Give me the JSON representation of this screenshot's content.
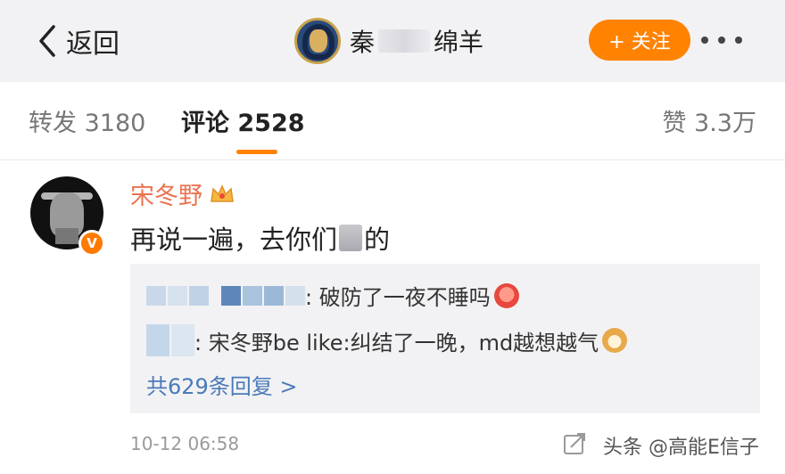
{
  "nav": {
    "back_label": "返回",
    "title_visible_start": "秦",
    "title_visible_end": "绵羊",
    "follow_label": "+ 关注"
  },
  "tabs": {
    "repost": "转发 3180",
    "comment": "评论 2528",
    "like": "赞 3.3万"
  },
  "comment": {
    "author": "宋冬野",
    "text_before": "再说一遍，去你们",
    "text_after": "的",
    "replies": [
      {
        "text": ": 破防了一夜不睡吗"
      },
      {
        "text": ": 宋冬野be like:纠结了一晚，md越想越气"
      }
    ],
    "more_replies": "共629条回复 >",
    "time": "10-12 06:58"
  },
  "watermark": "头条 @高能E信子",
  "colors": {
    "accent": "#ff8200",
    "author_name": "#eb7350",
    "link": "#4a7ab8",
    "nav_bg": "#f2f2f4"
  },
  "icons": [
    "back-chevron-icon",
    "more-dots-icon",
    "crown-icon",
    "verified-v-icon",
    "share-icon",
    "angry-emoji-icon",
    "dog-emoji-icon"
  ]
}
